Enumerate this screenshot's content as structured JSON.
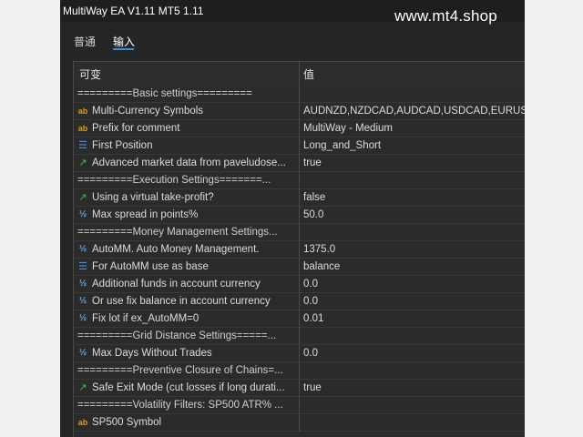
{
  "window": {
    "title": "MultiWay EA V1.11 MT5 1.11"
  },
  "watermark": "www.mt4.shop",
  "tabs": [
    {
      "label": "普通",
      "active": false
    },
    {
      "label": "输入",
      "active": true
    }
  ],
  "table": {
    "headers": {
      "variable": "可变",
      "value": "值"
    },
    "rows": [
      {
        "type": "section",
        "name": "=========Basic settings=========",
        "value": ""
      },
      {
        "type": "param",
        "icon": "ab",
        "name": "Multi-Currency Symbols",
        "value": "AUDNZD,NZDCAD,AUDCAD,USDCAD,EURUS..."
      },
      {
        "type": "param",
        "icon": "ab",
        "name": "Prefix for comment",
        "value": "MultiWay - Medium"
      },
      {
        "type": "param",
        "icon": "list",
        "name": "First Position",
        "value": "Long_and_Short"
      },
      {
        "type": "param",
        "icon": "bool",
        "name": "Advanced market data from paveludose...",
        "value": "true"
      },
      {
        "type": "section",
        "name": "=========Execution Settings=======...",
        "value": ""
      },
      {
        "type": "param",
        "icon": "bool",
        "name": "Using a virtual take-profit?",
        "value": "false"
      },
      {
        "type": "param",
        "icon": "num",
        "name": "Max spread in points%",
        "value": "50.0"
      },
      {
        "type": "section",
        "name": "=========Money Management Settings...",
        "value": ""
      },
      {
        "type": "param",
        "icon": "num",
        "name": "AutoMM. Auto Money Management.",
        "value": "1375.0"
      },
      {
        "type": "param",
        "icon": "list",
        "name": "For AutoMM use as base",
        "value": "balance"
      },
      {
        "type": "param",
        "icon": "num",
        "name": "Additional funds in account currency",
        "value": "0.0"
      },
      {
        "type": "param",
        "icon": "num",
        "name": "Or use fix balance in account currency",
        "value": "0.0"
      },
      {
        "type": "param",
        "icon": "num",
        "name": "Fix lot if ex_AutoMM=0",
        "value": "0.01"
      },
      {
        "type": "section",
        "name": "=========Grid Distance Settings=====...",
        "value": ""
      },
      {
        "type": "param",
        "icon": "num",
        "name": "Max Days Without Trades",
        "value": "0.0"
      },
      {
        "type": "section",
        "name": "=========Preventive Closure of Chains=...",
        "value": ""
      },
      {
        "type": "param",
        "icon": "bool",
        "name": "Safe Exit Mode (cut losses if long durati...",
        "value": "true"
      },
      {
        "type": "section",
        "name": "=========Volatility Filters: SP500 ATR% ...",
        "value": ""
      },
      {
        "type": "param",
        "icon": "ab",
        "name": "SP500 Symbol",
        "value": ""
      }
    ]
  },
  "icons": {
    "ab": "string-type-icon",
    "list": "enum-type-icon",
    "bool": "bool-type-icon",
    "num": "number-type-icon"
  },
  "colors": {
    "window_bg": "#252526",
    "grid_bg": "#2b2b2b",
    "text": "#dcdcdc",
    "accent": "#3c8dde"
  }
}
